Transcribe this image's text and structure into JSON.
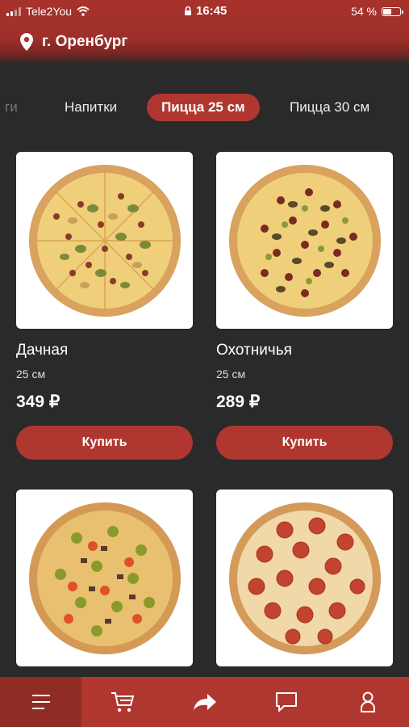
{
  "status": {
    "carrier": "Tele2You",
    "time": "16:45",
    "battery": "54 %",
    "battery_level": 0.54
  },
  "header": {
    "city": "г. Оренбург",
    "location_icon": "location-pin-icon"
  },
  "tabs": {
    "partial": "ги",
    "drinks": "Напитки",
    "pizza25": "Пицца 25 см",
    "pizza30": "Пицца 30 см"
  },
  "products": [
    {
      "name": "Дачная",
      "size": "25 см",
      "price": "349 ₽",
      "buy": "Купить"
    },
    {
      "name": "Охотничья",
      "size": "25 см",
      "price": "289 ₽",
      "buy": "Купить"
    },
    {
      "name": "",
      "size": "",
      "price": "",
      "buy": ""
    },
    {
      "name": "",
      "size": "",
      "price": "",
      "buy": ""
    }
  ],
  "nav": {
    "items": [
      "menu-icon",
      "cart-icon",
      "share-icon",
      "chat-icon",
      "profile-icon"
    ]
  },
  "colors": {
    "accent": "#b0372f",
    "background": "#2a2a2a"
  }
}
